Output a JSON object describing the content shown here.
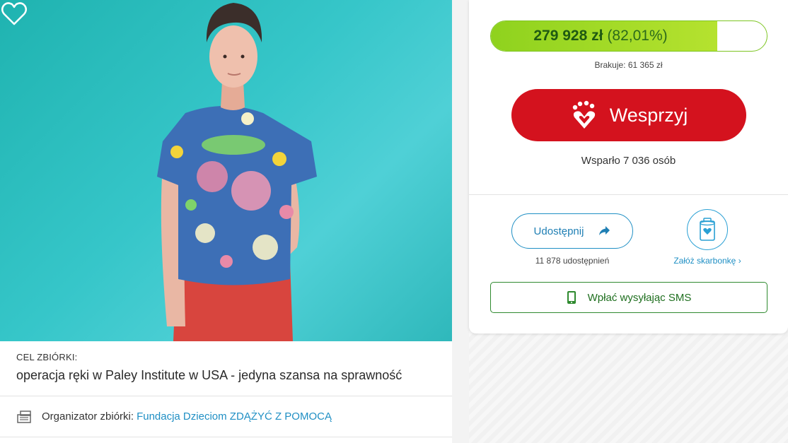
{
  "fundraiser": {
    "amount_raised": "279 928 zł",
    "percent_text": "(82,01%)",
    "percent": 82.01,
    "missing": "Brakuje: 61 365 zł",
    "support_button": "Wesprzyj",
    "supporters": "Wsparło 7 036 osób"
  },
  "share": {
    "button_label": "Udostępnij",
    "count": "11 878 udostępnień"
  },
  "piggybank": {
    "link": "Załóż skarbonkę ›"
  },
  "sms": {
    "button_label": "Wpłać wysyłając SMS"
  },
  "goal": {
    "label": "CEL ZBIÓRKI:",
    "text": "operacja ręki w Paley Institute w USA - jedyna szansa na sprawność"
  },
  "organizer": {
    "label": "Organizator zbiórki:",
    "name": "Fundacja Dzieciom ZDĄŻYĆ Z POMOCĄ"
  },
  "colors": {
    "brand_red": "#d4121e",
    "progress_green": "#8fd21e",
    "link_blue": "#1f8fc4",
    "sms_green": "#2f8a2f"
  },
  "icons": [
    "heart-outline-icon",
    "hand-heart-icon",
    "share-arrow-icon",
    "piggybank-icon",
    "phone-icon",
    "organizer-icon",
    "chevron-right-icon"
  ]
}
